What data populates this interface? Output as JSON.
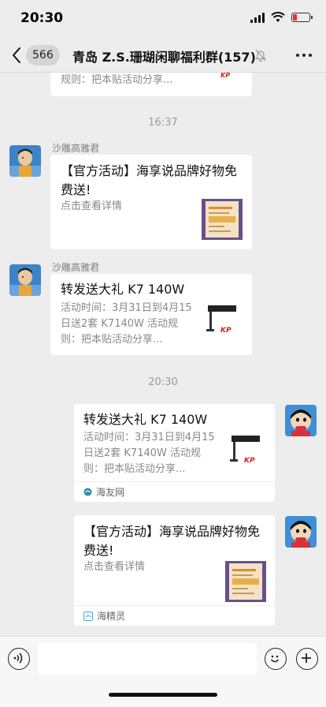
{
  "status_bar": {
    "time": "20:30"
  },
  "nav": {
    "unread_count": "566",
    "title": "青岛 Z.S.珊瑚闲聊福利群(157)"
  },
  "messages": {
    "top_partial": {
      "desc": "规则：把本贴活动分享..."
    },
    "ts1": "16:37",
    "m1": {
      "sender": "沙雕高雅君",
      "title": "【官方活动】海享说品牌好物免费送!",
      "desc": "点击查看详情"
    },
    "m2": {
      "sender": "沙雕高雅君",
      "title": "转发送大礼 K7 140W",
      "desc": "活动时间：3月31日到4月15日送2套 K7140W 活动规则：把本贴活动分享..."
    },
    "ts2": "20:30",
    "m3": {
      "title": "转发送大礼 K7 140W",
      "desc": "活动时间：3月31日到4月15日送2套 K7140W 活动规则：把本贴活动分享...",
      "source": "海友网"
    },
    "m4": {
      "title": "【官方活动】海享说品牌好物免费送!",
      "desc": "点击查看详情",
      "source": "海精灵"
    }
  },
  "icons": {
    "back": "chevron-left-icon",
    "mute": "bell-slash-icon",
    "more": "more-dots-icon",
    "voice": "voice-icon",
    "emoji": "emoji-icon",
    "plus": "plus-icon"
  },
  "colors": {
    "background": "#ededed",
    "card": "#ffffff",
    "battery_low": "#ef2d2d",
    "source_teal": "#2b8fa6"
  }
}
